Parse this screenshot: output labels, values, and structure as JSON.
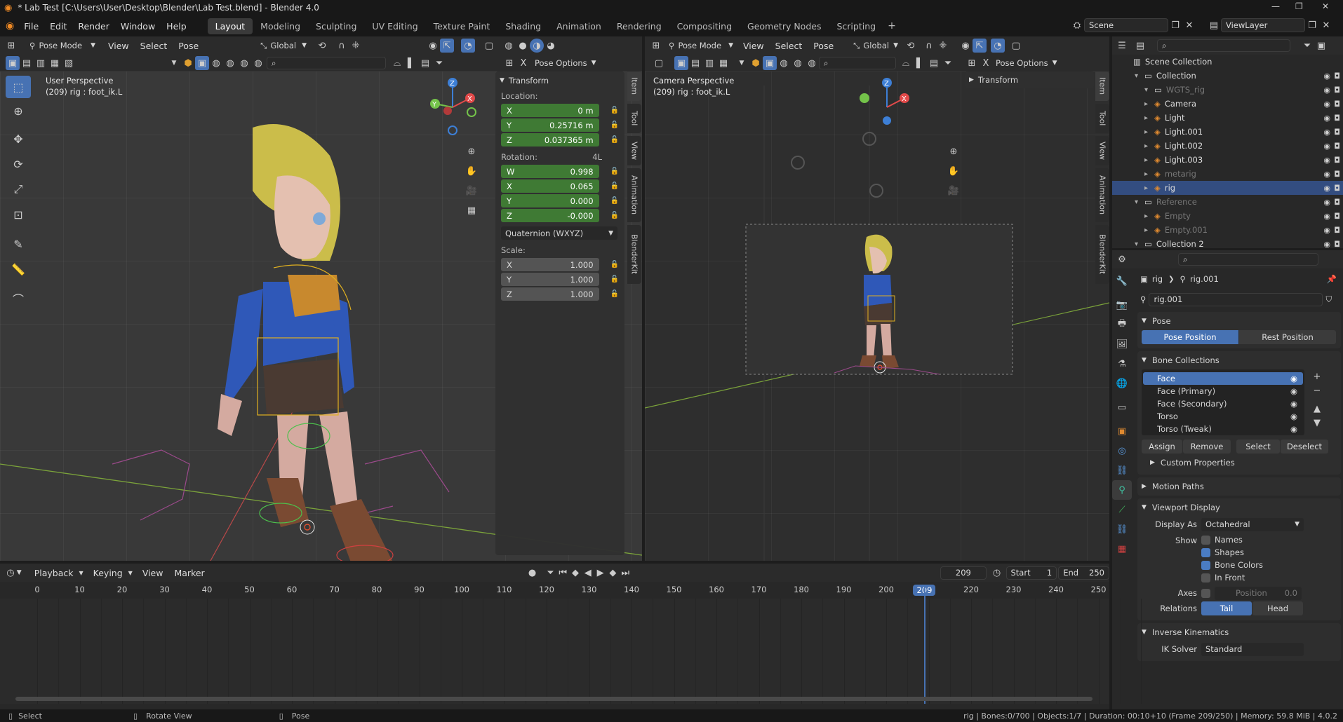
{
  "titlebar": {
    "title": "* Lab Test [C:\\Users\\User\\Desktop\\Blender\\Lab Test.blend] - Blender 4.0",
    "minimize": "—",
    "maximize": "❐",
    "close": "✕"
  },
  "menu": {
    "file": "File",
    "edit": "Edit",
    "render": "Render",
    "window": "Window",
    "help": "Help"
  },
  "workspaces": [
    "Layout",
    "Modeling",
    "Sculpting",
    "UV Editing",
    "Texture Paint",
    "Shading",
    "Animation",
    "Rendering",
    "Compositing",
    "Geometry Nodes",
    "Scripting"
  ],
  "active_workspace": "Layout",
  "scene": {
    "scene_name": "Scene",
    "view_layer": "ViewLayer"
  },
  "left_viewport": {
    "mode": "Pose Mode",
    "menus": [
      "View",
      "Select",
      "Pose"
    ],
    "orientation": "Global",
    "pose_options": "Pose Options",
    "perspective": "User Perspective",
    "object_info": "(209) rig : foot_ik.L",
    "transform_title": "Transform",
    "location_label": "Location:",
    "location": [
      {
        "axis": "X",
        "value": "0 m"
      },
      {
        "axis": "Y",
        "value": "0.25716 m"
      },
      {
        "axis": "Z",
        "value": "0.037365 m"
      }
    ],
    "rotation_label": "Rotation:",
    "rotation_mode_tag": "4L",
    "rotation": [
      {
        "axis": "W",
        "value": "0.998"
      },
      {
        "axis": "X",
        "value": "0.065"
      },
      {
        "axis": "Y",
        "value": "0.000"
      },
      {
        "axis": "Z",
        "value": "-0.000"
      }
    ],
    "rotation_mode": "Quaternion (WXYZ)",
    "scale_label": "Scale:",
    "scale": [
      {
        "axis": "X",
        "value": "1.000"
      },
      {
        "axis": "Y",
        "value": "1.000"
      },
      {
        "axis": "Z",
        "value": "1.000"
      }
    ],
    "side_tabs": [
      "Item",
      "Tool",
      "View",
      "Animation",
      "BlenderKit"
    ]
  },
  "right_viewport": {
    "mode": "Pose Mode",
    "menus": [
      "View",
      "Select",
      "Pose"
    ],
    "orientation": "Global",
    "pose_options": "Pose Options",
    "perspective": "Camera Perspective",
    "object_info": "(209) rig : foot_ik.L",
    "transform_title": "Transform",
    "side_tabs": [
      "Item",
      "Tool",
      "View",
      "Animation",
      "BlenderKit"
    ]
  },
  "outliner": {
    "title": "Scene Collection",
    "rows": [
      {
        "name": "Collection",
        "indent": 1,
        "kind": "collection"
      },
      {
        "name": "WGTS_rig",
        "indent": 2,
        "kind": "collection-dim"
      },
      {
        "name": "Camera",
        "indent": 2,
        "kind": "object"
      },
      {
        "name": "Light",
        "indent": 2,
        "kind": "object"
      },
      {
        "name": "Light.001",
        "indent": 2,
        "kind": "object"
      },
      {
        "name": "Light.002",
        "indent": 2,
        "kind": "object"
      },
      {
        "name": "Light.003",
        "indent": 2,
        "kind": "object"
      },
      {
        "name": "metarig",
        "indent": 2,
        "kind": "object-dim"
      },
      {
        "name": "rig",
        "indent": 2,
        "kind": "selected"
      },
      {
        "name": "Reference",
        "indent": 1,
        "kind": "collection-dim"
      },
      {
        "name": "Empty",
        "indent": 2,
        "kind": "object-dim"
      },
      {
        "name": "Empty.001",
        "indent": 2,
        "kind": "object-dim"
      },
      {
        "name": "Collection 2",
        "indent": 1,
        "kind": "collection"
      }
    ]
  },
  "properties": {
    "breadcrumb": [
      "rig",
      "rig.001"
    ],
    "armature_name": "rig.001",
    "pose_section": "Pose",
    "pose_position": "Pose Position",
    "rest_position": "Rest Position",
    "bone_collections_section": "Bone Collections",
    "bone_collections": [
      "Face",
      "Face (Primary)",
      "Face (Secondary)",
      "Torso",
      "Torso (Tweak)"
    ],
    "bc_buttons": [
      "Assign",
      "Remove",
      "Select",
      "Deselect"
    ],
    "custom_properties": "Custom Properties",
    "motion_paths": "Motion Paths",
    "viewport_display": "Viewport Display",
    "display_as_label": "Display As",
    "display_as": "Octahedral",
    "show_label": "Show",
    "show_options": [
      {
        "label": "Names",
        "checked": false
      },
      {
        "label": "Shapes",
        "checked": true
      },
      {
        "label": "Bone Colors",
        "checked": true
      },
      {
        "label": "In Front",
        "checked": false
      }
    ],
    "axes_label": "Axes",
    "axes_position": "Position",
    "axes_value": "0.0",
    "relations_label": "Relations",
    "relations_tail": "Tail",
    "relations_head": "Head",
    "inverse_kinematics": "Inverse Kinematics",
    "ik_solver_label": "IK Solver",
    "ik_solver": "Standard"
  },
  "timeline": {
    "menus": [
      "Playback",
      "Keying",
      "View",
      "Marker"
    ],
    "current_frame": "209",
    "start_label": "Start",
    "start": "1",
    "end_label": "End",
    "end": "250",
    "ticks": [
      "0",
      "10",
      "20",
      "30",
      "40",
      "50",
      "60",
      "70",
      "80",
      "90",
      "100",
      "110",
      "120",
      "130",
      "140",
      "150",
      "160",
      "170",
      "180",
      "190",
      "200",
      "209",
      "220",
      "230",
      "240",
      "250"
    ]
  },
  "statusbar": {
    "select": "Select",
    "rotate_view": "Rotate View",
    "pose": "Pose",
    "stats": "rig | Bones:0/700 | Objects:1/7 | Duration: 00:10+10 (Frame 209/250) | Memory: 59.8 MiB | 4.0.2"
  },
  "colors": {
    "accent": "#4772b3",
    "green_field": "#3f7a34",
    "playhead": "#4772b3",
    "axis_x": "#e24a4a",
    "axis_y": "#74c34a",
    "axis_z": "#3d7fd6"
  }
}
